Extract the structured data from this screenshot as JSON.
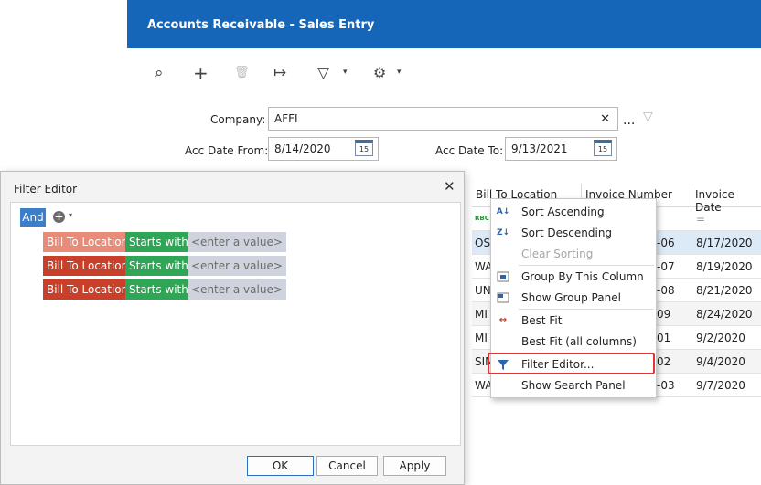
{
  "window": {
    "title": "Accounts Receivable - Sales Entry"
  },
  "toolbar": {
    "icons": [
      "search-icon",
      "add-icon",
      "delete-icon",
      "goto-icon",
      "filter-icon",
      "settings-icon"
    ],
    "search_glyph": "⌕",
    "add_glyph": "+",
    "delete_glyph": "🗑",
    "goto_glyph": "↦",
    "filter_glyph": "▽",
    "settings_glyph": "⚙",
    "caret_glyph": "▾"
  },
  "form": {
    "company_label": "Company:",
    "company_value": "AFFI",
    "clear_glyph": "✕",
    "more_glyph": "...",
    "acc_from_label": "Acc Date From:",
    "acc_from_value": "8/14/2020",
    "acc_to_label": "Acc Date To:",
    "acc_to_value": "9/13/2021",
    "calendar_glyph": "15"
  },
  "grid": {
    "headers": [
      "Bill To Location",
      "Invoice Number",
      "Invoice Date"
    ],
    "filter_row_badge": "RBC",
    "filter_row_equals": "=",
    "rows": [
      {
        "loc": "OS",
        "inv": "-06",
        "date": "8/17/2020"
      },
      {
        "loc": "WA",
        "inv": "-07",
        "date": "8/19/2020"
      },
      {
        "loc": "UN",
        "inv": "-08",
        "date": "8/21/2020"
      },
      {
        "loc": "MI",
        "inv": "09",
        "date": "8/24/2020"
      },
      {
        "loc": "MI",
        "inv": "01",
        "date": "9/2/2020"
      },
      {
        "loc": "SIN",
        "inv": "02",
        "date": "9/4/2020"
      },
      {
        "loc": "WA",
        "inv": "-03",
        "date": "9/7/2020"
      }
    ]
  },
  "context_menu": {
    "items": [
      {
        "label": "Sort Ascending",
        "icon": "sort-ascending-icon"
      },
      {
        "label": "Sort Descending",
        "icon": "sort-descending-icon"
      },
      {
        "label": "Clear Sorting",
        "icon": "",
        "disabled": true
      },
      {
        "label": "Group By This Column",
        "icon": "group-by-icon"
      },
      {
        "label": "Show Group Panel",
        "icon": "group-panel-icon"
      },
      {
        "label": "Best Fit",
        "icon": "best-fit-icon"
      },
      {
        "label": "Best Fit (all columns)",
        "icon": ""
      },
      {
        "label": "Filter Editor...",
        "icon": "filter-icon"
      },
      {
        "label": "Show Search Panel",
        "icon": ""
      }
    ],
    "sort_asc_glyph": "A↓",
    "sort_desc_glyph": "Z↓",
    "bestfit_glyph": "↔"
  },
  "filter_editor": {
    "title": "Filter Editor",
    "close_glyph": "✕",
    "group_operator": "And",
    "add_glyph": "+",
    "caret_glyph": "▾",
    "conditions": [
      {
        "field": "Bill To Location",
        "operator": "Starts with",
        "value": "<enter a value>"
      },
      {
        "field": "Bill To Location",
        "operator": "Starts with",
        "value": "<enter a value>"
      },
      {
        "field": "Bill To Location",
        "operator": "Starts with",
        "value": "<enter a value>"
      }
    ],
    "ok_label": "OK",
    "cancel_label": "Cancel",
    "apply_label": "Apply"
  },
  "colors": {
    "titlebar": "#1565b8",
    "field_chip": "#c9402a",
    "operator_chip": "#2fa656",
    "value_chip": "#cfd3dd",
    "highlight": "#e03535",
    "selected_row": "#dce9f7"
  }
}
